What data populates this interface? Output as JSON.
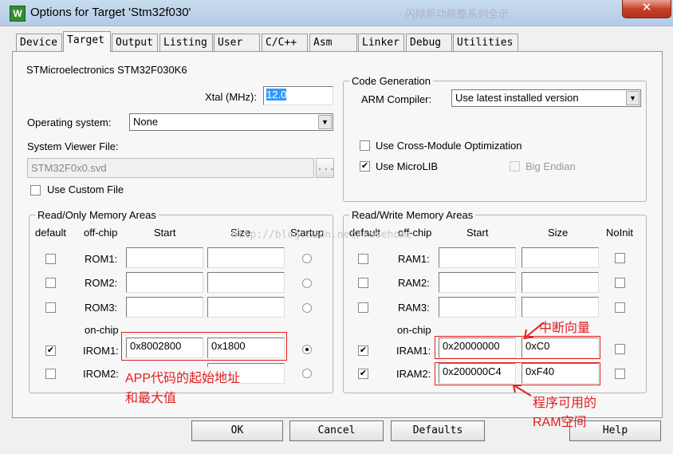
{
  "window": {
    "title": "Options for Target 'Stm32f030'",
    "icon_text": "W",
    "close": "✕",
    "ghost_text": "· 闪除新功能整系列全示"
  },
  "tabs": [
    "Device",
    "Target",
    "Output",
    "Listing",
    "User",
    "C/C++",
    "Asm",
    "Linker",
    "Debug",
    "Utilities"
  ],
  "active_tab": "Target",
  "device_name": "STMicroelectronics STM32F030K6",
  "xtal": {
    "label": "Xtal (MHz):",
    "value": "12.0"
  },
  "os": {
    "label": "Operating system:",
    "value": "None"
  },
  "svd": {
    "label": "System Viewer File:",
    "value": "STM32F0x0.svd",
    "browse": "..."
  },
  "custom_file": {
    "label": "Use Custom File",
    "checked": false
  },
  "code_gen": {
    "title": "Code Generation",
    "compiler_label": "ARM Compiler:",
    "compiler_value": "Use latest installed version",
    "cross_module": {
      "label": "Use Cross-Module Optimization",
      "checked": false
    },
    "microlib": {
      "label": "Use MicroLIB",
      "checked": true
    },
    "big_endian": {
      "label": "Big Endian",
      "checked": false,
      "disabled": true
    }
  },
  "rom_areas": {
    "title": "Read/Only Memory Areas",
    "headers": {
      "default": "default",
      "offchip": "off-chip",
      "start": "Start",
      "size": "Size",
      "startup": "Startup"
    },
    "onchip_label": "on-chip",
    "rows": [
      {
        "name": "ROM1:",
        "start": "",
        "size": "",
        "default": false,
        "startup": false
      },
      {
        "name": "ROM2:",
        "start": "",
        "size": "",
        "default": false,
        "startup": false
      },
      {
        "name": "ROM3:",
        "start": "",
        "size": "",
        "default": false,
        "startup": false
      },
      {
        "name": "IROM1:",
        "start": "0x8002800",
        "size": "0x1800",
        "default": true,
        "startup": true
      },
      {
        "name": "IROM2:",
        "start": "",
        "size": "",
        "default": false,
        "startup": false
      }
    ]
  },
  "ram_areas": {
    "title": "Read/Write Memory Areas",
    "headers": {
      "default": "default",
      "offchip": "off-chip",
      "start": "Start",
      "size": "Size",
      "noinit": "NoInit"
    },
    "onchip_label": "on-chip",
    "rows": [
      {
        "name": "RAM1:",
        "start": "",
        "size": "",
        "default": false,
        "noinit": false
      },
      {
        "name": "RAM2:",
        "start": "",
        "size": "",
        "default": false,
        "noinit": false
      },
      {
        "name": "RAM3:",
        "start": "",
        "size": "",
        "default": false,
        "noinit": false
      },
      {
        "name": "IRAM1:",
        "start": "0x20000000",
        "size": "0xC0",
        "default": true,
        "noinit": false
      },
      {
        "name": "IRAM2:",
        "start": "0x200000C4",
        "size": "0xF40",
        "default": true,
        "noinit": false
      }
    ]
  },
  "watermark": "http://blog.csdn.net/rosehome",
  "annotations": {
    "app_line1": "APP代码的起始地址",
    "app_line2": "和最大值",
    "vector": "中断向量",
    "ram_line1": "程序可用的",
    "ram_line2": "RAM空间"
  },
  "buttons": {
    "ok": "OK",
    "cancel": "Cancel",
    "defaults": "Defaults",
    "help": "Help"
  },
  "colors": {
    "annotation": "#e02020",
    "titlebar": "#bcd2ea",
    "close": "#c7422c"
  }
}
